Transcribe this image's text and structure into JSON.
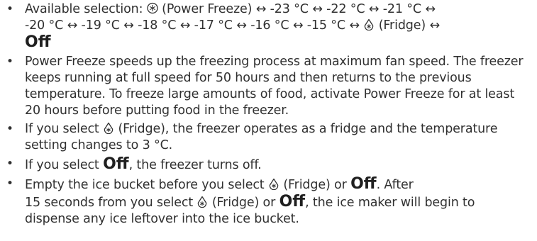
{
  "icons": {
    "power_freeze": "power-freeze-icon",
    "fridge": "fridge-icon"
  },
  "off_label": "Off",
  "items": [
    {
      "line1": "Available selection: ",
      "power_freeze_label": " (Power Freeze) ↔ -23 °C ↔ -22 °C ↔ -21 °C ↔",
      "line2": "-20 °C ↔ -19 °C ↔ -18 °C ↔ -17 °C ↔ -16 °C ↔ -15 °C ↔ ",
      "fridge_label": " (Fridge) ↔"
    },
    {
      "text": "Power Freeze speeds up the freezing process at maximum fan speed. The freezer keeps running at full speed for 50 hours and then returns to the previous temperature. To freeze large amounts of food, activate Power Freeze for at least 20 hours before putting food in the freezer."
    },
    {
      "pre": "If you select ",
      "fridge_label": " (Fridge), the freezer operates as a fridge and the temperature setting changes to 3 °C."
    },
    {
      "pre": "If you select ",
      "post": ", the freezer turns off."
    },
    {
      "pre": "Empty the ice bucket before you select ",
      "mid": " (Fridge) or ",
      "post1": ". After",
      "post2": "15 seconds from you select ",
      "mid2": " (Fridge) or ",
      "post3": ", the ice maker will begin to dispense any ice leftover into the ice bucket."
    }
  ]
}
